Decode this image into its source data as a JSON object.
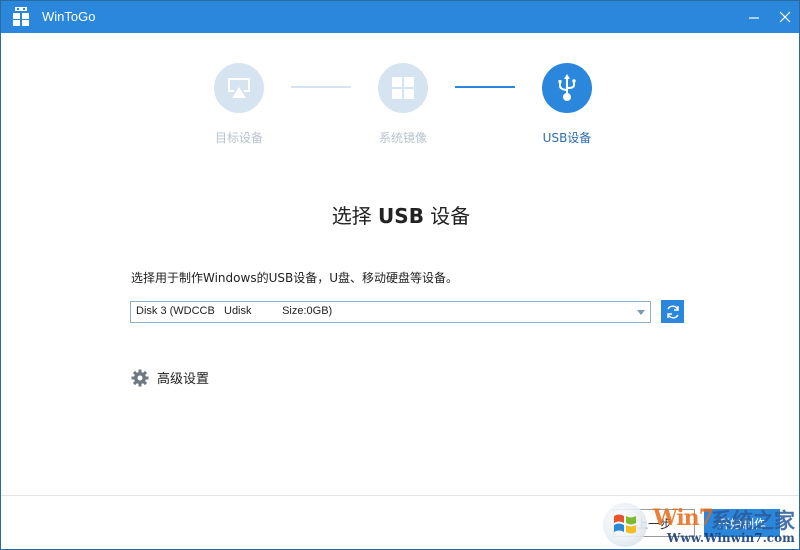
{
  "window": {
    "title": "WinToGo",
    "minimize_icon": "minimize-icon",
    "close_icon": "close-icon"
  },
  "steps": [
    {
      "label": "目标设备",
      "icon": "monitor-cast-icon",
      "state": "inactive"
    },
    {
      "label": "系统镜像",
      "icon": "windows-logo-icon",
      "state": "inactive"
    },
    {
      "label": "USB设备",
      "icon": "usb-icon",
      "state": "active"
    }
  ],
  "main": {
    "heading_prefix": "选择 ",
    "heading_bold": "USB",
    "heading_suffix": " 设备",
    "description": "选择用于制作Windows的USB设备，U盘、移动硬盘等设备。",
    "device_select": {
      "selected": "Disk 3 (WDCCB   Udisk          Size:0GB)"
    },
    "refresh_icon": "refresh-icon",
    "advanced_label": "高级设置",
    "advanced_icon": "gear-icon"
  },
  "footer": {
    "prev_label": "上一步",
    "start_label": "开始制作"
  },
  "watermark": {
    "brand_latin": "Win7",
    "brand_cn": "系统之家",
    "url": "Www.Winwin7.com"
  },
  "colors": {
    "accent": "#2b87dc",
    "inactive_step": "#d6e4f2",
    "active_label": "#2b6fb0"
  }
}
